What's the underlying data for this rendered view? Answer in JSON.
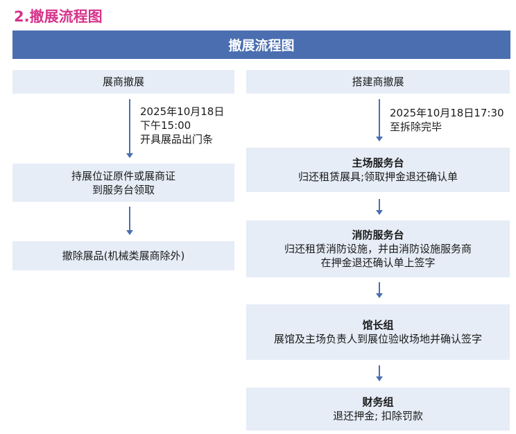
{
  "heading": "2.撤展流程图",
  "banner": "撤展流程图",
  "left": {
    "header": "展商撤展",
    "note": [
      "2025年10月18日",
      "下午15:00",
      "开具展品出门条"
    ],
    "step1": [
      "持展位证原件或展商证",
      "到服务台领取"
    ],
    "step2": "撤除展品(机械类展商除外)"
  },
  "right": {
    "header": "搭建商撤展",
    "note": [
      "2025年10月18日17:30",
      "至拆除完毕"
    ],
    "steps": [
      {
        "title": "主场服务台",
        "lines": [
          "归还租赁展具;领取押金退还确认单"
        ]
      },
      {
        "title": "消防服务台",
        "lines": [
          "归还租赁消防设施，并由消防设施服务商",
          "在押金退还确认单上签字"
        ]
      },
      {
        "title": "馆长组",
        "lines": [
          "展馆及主场负责人到展位验收场地并确认签字"
        ]
      },
      {
        "title": "财务组",
        "lines": [
          "退还押金; 扣除罚款"
        ]
      }
    ]
  },
  "colors": {
    "heading": "#d6338b",
    "banner": "#4a6eb0",
    "box": "#e6edf7",
    "arrow": "#4a6eb0"
  }
}
